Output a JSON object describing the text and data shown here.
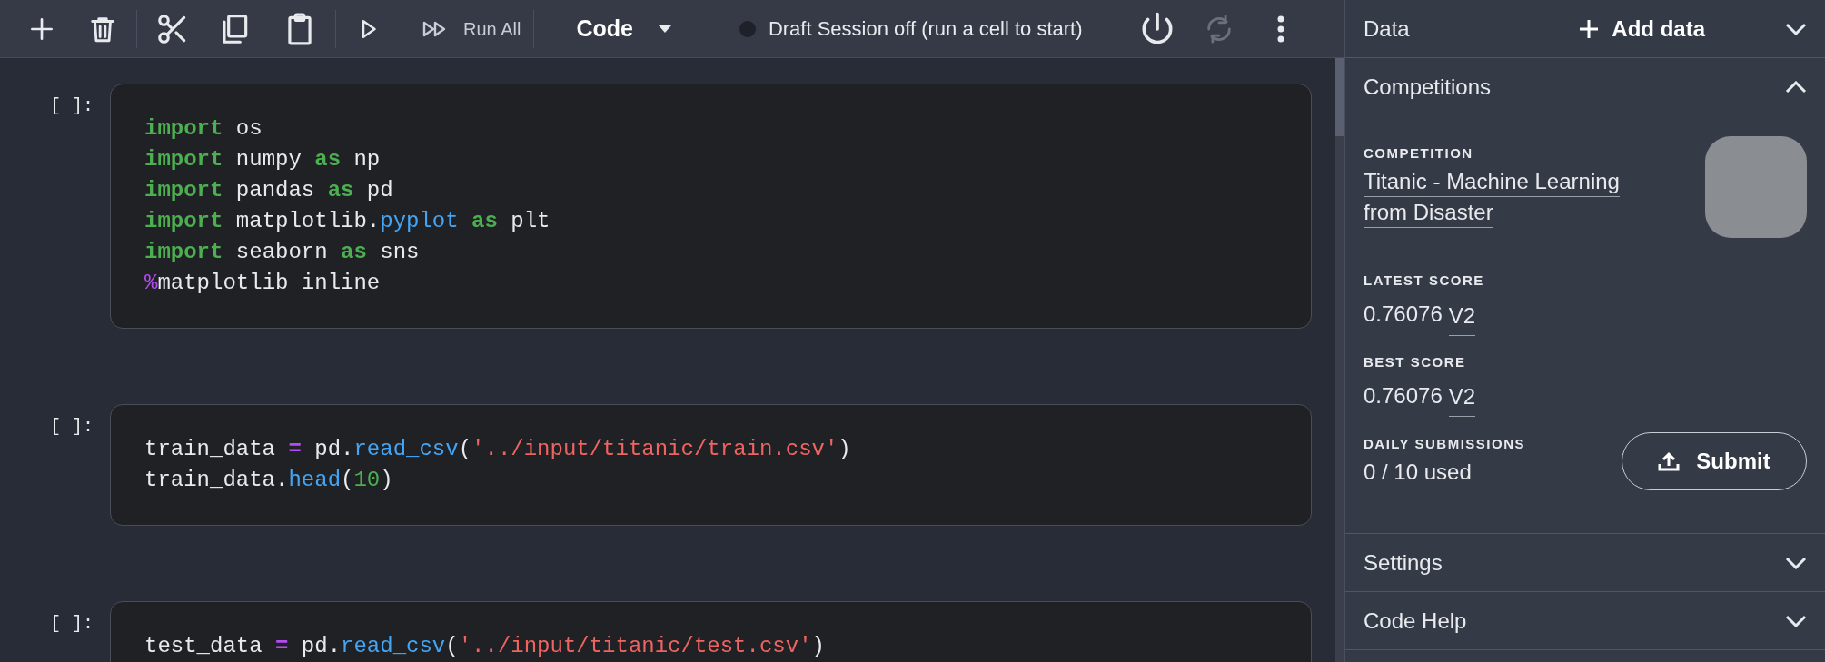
{
  "toolbar": {
    "run_all_label": "Run All",
    "cell_type": "Code",
    "session": {
      "label": "Draft Session off (run a cell to start)",
      "running": false
    },
    "restart_disabled": true
  },
  "cells": [
    {
      "prompt": "[ ]:",
      "lines": [
        [
          {
            "kind": "keyword",
            "text": "import"
          },
          {
            "kind": "plain",
            "text": " os"
          }
        ],
        [
          {
            "kind": "keyword",
            "text": "import"
          },
          {
            "kind": "plain",
            "text": " numpy "
          },
          {
            "kind": "keyword",
            "text": "as"
          },
          {
            "kind": "plain",
            "text": " np"
          }
        ],
        [
          {
            "kind": "keyword",
            "text": "import"
          },
          {
            "kind": "plain",
            "text": " pandas "
          },
          {
            "kind": "keyword",
            "text": "as"
          },
          {
            "kind": "plain",
            "text": " pd"
          }
        ],
        [
          {
            "kind": "keyword",
            "text": "import"
          },
          {
            "kind": "plain",
            "text": " matplotlib."
          },
          {
            "kind": "function",
            "text": "pyplot"
          },
          {
            "kind": "keyword",
            "text": " as"
          },
          {
            "kind": "plain",
            "text": " plt"
          }
        ],
        [
          {
            "kind": "keyword",
            "text": "import"
          },
          {
            "kind": "plain",
            "text": " seaborn "
          },
          {
            "kind": "keyword",
            "text": "as"
          },
          {
            "kind": "plain",
            "text": " sns"
          }
        ],
        [
          {
            "kind": "magic",
            "text": "%"
          },
          {
            "kind": "plain",
            "text": "matplotlib inline"
          }
        ]
      ]
    },
    {
      "prompt": "[ ]:",
      "lines": [
        [
          {
            "kind": "plain",
            "text": "train_data "
          },
          {
            "kind": "operator",
            "text": "="
          },
          {
            "kind": "plain",
            "text": " pd."
          },
          {
            "kind": "function",
            "text": "read_csv"
          },
          {
            "kind": "plain",
            "text": "("
          },
          {
            "kind": "string",
            "text": "'../input/titanic/train.csv'"
          },
          {
            "kind": "plain",
            "text": ")"
          }
        ],
        [
          {
            "kind": "plain",
            "text": "train_data."
          },
          {
            "kind": "function",
            "text": "head"
          },
          {
            "kind": "plain",
            "text": "("
          },
          {
            "kind": "number",
            "text": "10"
          },
          {
            "kind": "plain",
            "text": ")"
          }
        ]
      ]
    },
    {
      "prompt": "[ ]:",
      "lines": [
        [
          {
            "kind": "plain",
            "text": "test_data "
          },
          {
            "kind": "operator",
            "text": "="
          },
          {
            "kind": "plain",
            "text": " pd."
          },
          {
            "kind": "function",
            "text": "read_csv"
          },
          {
            "kind": "plain",
            "text": "("
          },
          {
            "kind": "string",
            "text": "'../input/titanic/test.csv'"
          },
          {
            "kind": "plain",
            "text": ")"
          }
        ]
      ]
    }
  ],
  "sidebar": {
    "sections": [
      {
        "title": "Data",
        "expanded": false,
        "action": "Add data"
      },
      {
        "title": "Competitions",
        "expanded": true,
        "competition": {
          "label": "COMPETITION",
          "name": "Titanic - Machine Learning from Disaster",
          "latest_score": {
            "label": "LATEST SCORE",
            "value": "0.76076",
            "version": "V2"
          },
          "best_score": {
            "label": "BEST SCORE",
            "value": "0.76076",
            "version": "V2"
          },
          "daily_submissions": {
            "label": "DAILY SUBMISSIONS",
            "value": "0 / 10 used"
          },
          "submit_label": "Submit"
        }
      },
      {
        "title": "Settings",
        "expanded": false
      },
      {
        "title": "Code Help",
        "expanded": false
      }
    ]
  }
}
